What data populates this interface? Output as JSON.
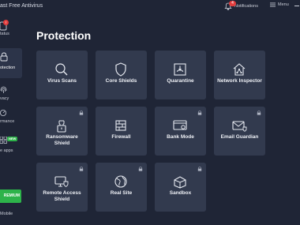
{
  "app": {
    "title": "ast Free Antivirus",
    "notifications_label": "Notifications",
    "notifications_count": "4",
    "menu_label": "Menu"
  },
  "sidebar": {
    "items": [
      {
        "label": "tatus",
        "badge": "!"
      },
      {
        "label": "otection"
      },
      {
        "label": "vacy"
      },
      {
        "label": "rmance"
      },
      {
        "label": "e apps",
        "badge": "NEW"
      }
    ],
    "premium_label": "REMIUM",
    "mobile_label": "Mobile"
  },
  "page": {
    "title": "Protection"
  },
  "tiles": [
    {
      "label": "Virus Scans",
      "icon": "magnifier-icon",
      "locked": false
    },
    {
      "label": "Core Shields",
      "icon": "shield-icon",
      "locked": false
    },
    {
      "label": "Quarantine",
      "icon": "quarantine-icon",
      "locked": false
    },
    {
      "label": "Network Inspector",
      "icon": "network-house-icon",
      "locked": false
    },
    {
      "label": "Ransomware Shield",
      "icon": "ransomware-shield-icon",
      "locked": true
    },
    {
      "label": "Firewall",
      "icon": "firewall-icon",
      "locked": false
    },
    {
      "label": "Bank Mode",
      "icon": "bank-mode-icon",
      "locked": true
    },
    {
      "label": "Email Guardian",
      "icon": "email-icon",
      "locked": true
    },
    {
      "label": "Remote Access Shield",
      "icon": "remote-access-icon",
      "locked": true
    },
    {
      "label": "Real Site",
      "icon": "globe-icon",
      "locked": true
    },
    {
      "label": "Sandbox",
      "icon": "sandbox-icon",
      "locked": true
    }
  ],
  "colors": {
    "background": "#1f2536",
    "tile": "#323a4e",
    "accent_green": "#2db34a",
    "alert_red": "#e23d3d"
  }
}
